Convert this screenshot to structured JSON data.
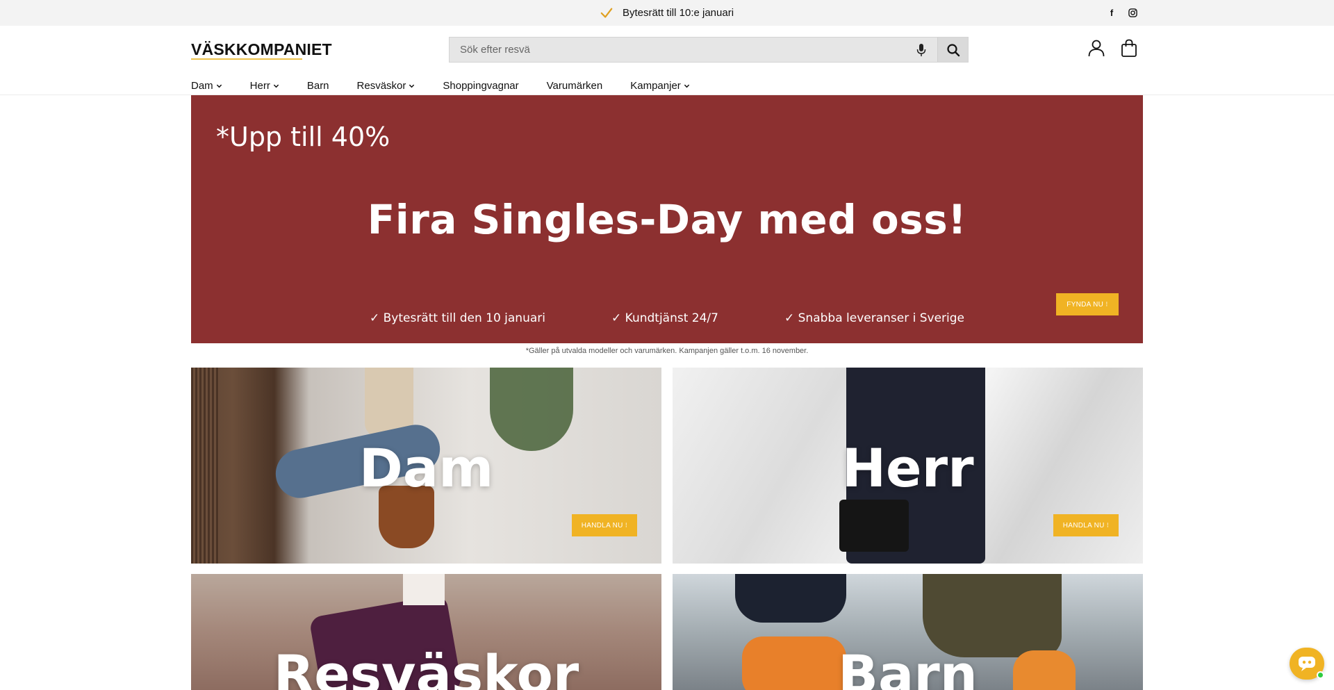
{
  "announcement": {
    "text": "Bytesrätt till 10:e januari",
    "icon": "checkmark-icon"
  },
  "social": {
    "facebook": "f",
    "instagram": "instagram-icon"
  },
  "header": {
    "logo": "VÄSKKOMPANIET",
    "search_placeholder": "Sök efter resvä",
    "icons": [
      "microphone-icon",
      "search-icon",
      "account-icon",
      "cart-icon"
    ]
  },
  "nav": {
    "items": [
      {
        "label": "Dam",
        "dropdown": true
      },
      {
        "label": "Herr",
        "dropdown": true
      },
      {
        "label": "Barn",
        "dropdown": false
      },
      {
        "label": "Resväskor",
        "dropdown": true
      },
      {
        "label": "Shoppingvagnar",
        "dropdown": false
      },
      {
        "label": "Varumärken",
        "dropdown": false
      },
      {
        "label": "Kampanjer",
        "dropdown": true
      }
    ]
  },
  "hero": {
    "subtitle": "*Upp till 40%",
    "title": "Fira Singles-Day med oss!",
    "perks": [
      "✓ Bytesrätt till den 10 januari",
      "✓ Kundtjänst 24/7",
      "✓ Snabba leveranser i Sverige"
    ],
    "cta": "FYNDA NU ⁝",
    "background": "#8c3030"
  },
  "disclaimer": "*Gäller på utvalda modeller och varumärken. Kampanjen gäller t.o.m. 16 november.",
  "tiles": [
    {
      "label": "Dam",
      "cta": "HANDLA NU ⁝"
    },
    {
      "label": "Herr",
      "cta": "HANDLA NU ⁝"
    },
    {
      "label": "Resväskor"
    },
    {
      "label": "Barn"
    }
  ],
  "colors": {
    "accent": "#f0b324",
    "hero_bg": "#8c3030",
    "topbar_bg": "#f3f3f3"
  },
  "chat": {
    "icon": "chat-bot-icon",
    "status": "online"
  }
}
